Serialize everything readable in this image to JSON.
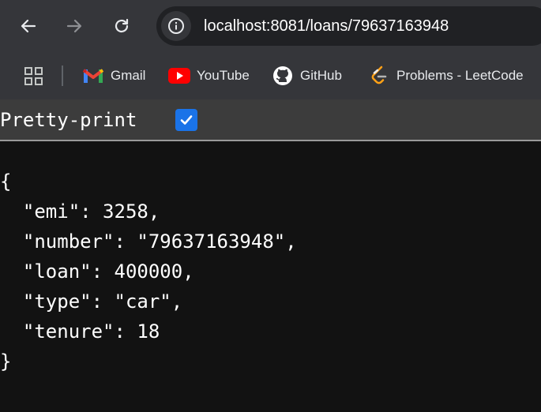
{
  "nav": {
    "back_icon": "back-arrow-icon",
    "forward_icon": "forward-arrow-icon",
    "reload_icon": "reload-icon"
  },
  "address_bar": {
    "host": "localhost:8081",
    "path": "/loans/79637163948",
    "site_info_icon": "info-icon"
  },
  "bookmarks": [
    {
      "label": "Gmail",
      "icon": "gmail-icon"
    },
    {
      "label": "YouTube",
      "icon": "youtube-icon"
    },
    {
      "label": "GitHub",
      "icon": "github-icon"
    },
    {
      "label": "Problems - LeetCode",
      "icon": "leetcode-icon"
    }
  ],
  "pretty_print": {
    "label": "Pretty-print",
    "checked": true
  },
  "json_lines": [
    "{",
    "  \"emi\": 3258,",
    "  \"number\": \"79637163948\",",
    "  \"loan\": 400000,",
    "  \"type\": \"car\",",
    "  \"tenure\": 18",
    "}"
  ],
  "colors": {
    "toolbar": "#35363a",
    "omnibox": "#202124",
    "page_background": "#121212",
    "checkbox": "#1a73e8",
    "youtube_red": "#ff0000"
  }
}
